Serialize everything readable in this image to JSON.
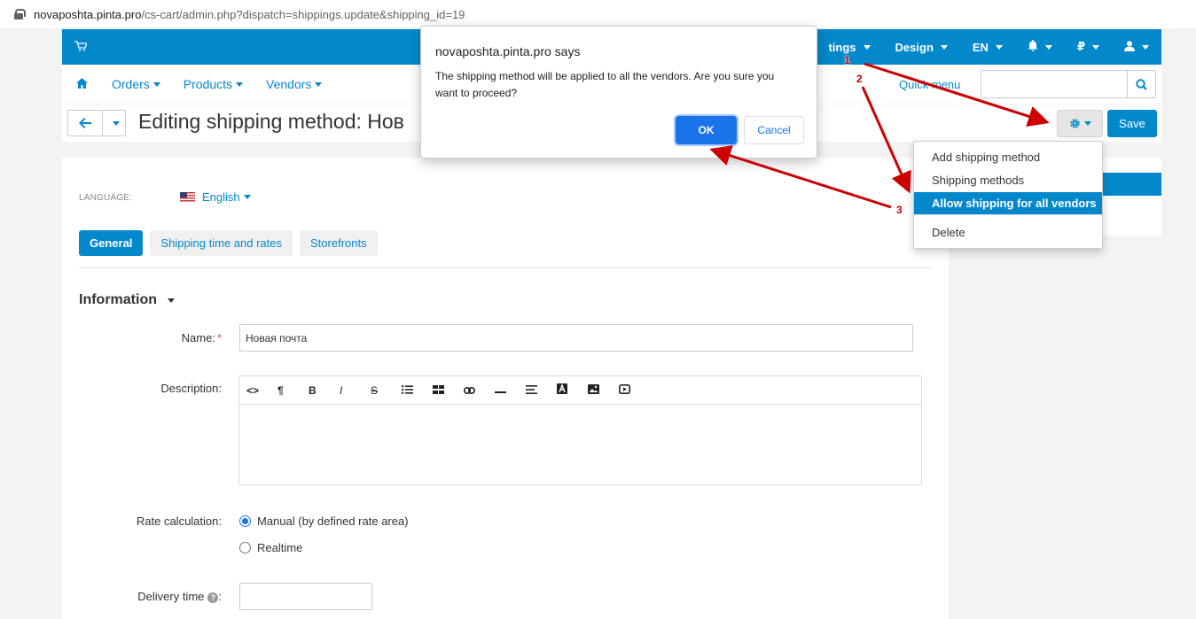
{
  "browser": {
    "domain": "novaposhta.pinta.pro",
    "path": "/cs-cart/admin.php?dispatch=shippings.update&shipping_id=19"
  },
  "topnav": {
    "items": [
      {
        "label": "tings"
      },
      {
        "label": "Design"
      },
      {
        "label": "EN"
      },
      {
        "label": ""
      },
      {
        "label": "₽"
      },
      {
        "label": ""
      }
    ]
  },
  "subnav": {
    "items": [
      {
        "label": "Orders"
      },
      {
        "label": "Products"
      },
      {
        "label": "Vendors"
      }
    ],
    "quick_menu": "Quick menu",
    "search_value": ""
  },
  "titlebar": {
    "title": "Editing shipping method: Нов",
    "save_label": "Save"
  },
  "dropdown": {
    "items": [
      {
        "label": "Add shipping method"
      },
      {
        "label": "Shipping methods"
      },
      {
        "label": "Allow shipping for all vendors"
      },
      {
        "label": "Delete"
      }
    ]
  },
  "form": {
    "language_label": "LANGUAGE:",
    "language_value": "English",
    "tabs": [
      {
        "label": "General"
      },
      {
        "label": "Shipping time and rates"
      },
      {
        "label": "Storefronts"
      }
    ],
    "section_title": "Information",
    "name_label": "Name:",
    "name_required": "*",
    "name_value": "Новая почта",
    "description_label": "Description:",
    "rate_label": "Rate calculation:",
    "rate_options": [
      {
        "label": "Manual (by defined rate area)"
      },
      {
        "label": "Realtime"
      }
    ],
    "delivery_label": "Delivery time",
    "delivery_value": ""
  },
  "alert": {
    "title": "novaposhta.pinta.pro says",
    "message": "The shipping method will be applied to all the vendors. Are you sure you want to proceed?",
    "ok_label": "OK",
    "cancel_label": "Cancel"
  },
  "annotations": {
    "labels": [
      "1",
      "2",
      "3"
    ],
    "color": "#cc0000"
  },
  "colors": {
    "accent": "#0388cc",
    "dialog_button": "#1a73e8"
  }
}
